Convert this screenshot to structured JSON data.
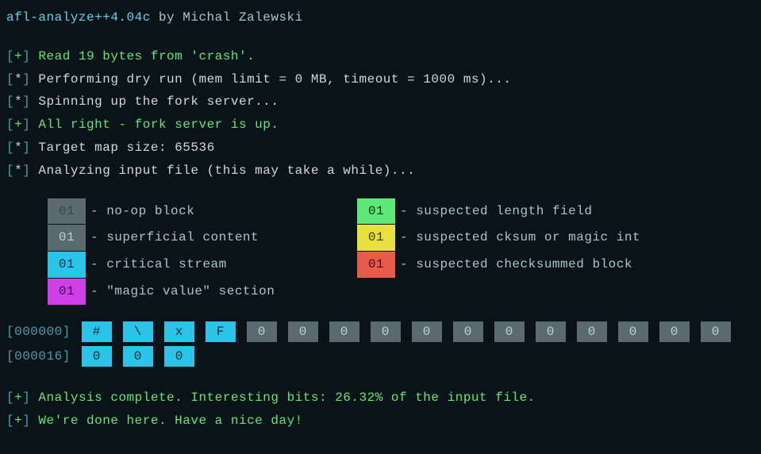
{
  "header": {
    "title": "afl-analyze++4.04c",
    "by": " by Michal Zalewski"
  },
  "logs": [
    {
      "prefix": "[+]",
      "type": "plus",
      "text": " Read 19 bytes from 'crash'."
    },
    {
      "prefix": "[*]",
      "type": "star",
      "text": " Performing dry run (mem limit = 0 MB, timeout = 1000 ms)..."
    },
    {
      "prefix": "[*]",
      "type": "star",
      "text": " Spinning up the fork server..."
    },
    {
      "prefix": "[+]",
      "type": "plus",
      "text": " All right - fork server is up."
    },
    {
      "prefix": "[*]",
      "type": "star",
      "text": " Target map size: 65536"
    },
    {
      "prefix": "[*]",
      "type": "star",
      "text": " Analyzing input file (this may take a while)..."
    }
  ],
  "legend": [
    [
      {
        "swatch": "swatch-gray",
        "code": "01",
        "label": " - no-op block"
      },
      {
        "swatch": "swatch-green",
        "code": "01",
        "label": " - suspected length field"
      }
    ],
    [
      {
        "swatch": "swatch-lightgray",
        "code": "01",
        "label": " - superficial content"
      },
      {
        "swatch": "swatch-yellow",
        "code": "01",
        "label": " - suspected cksum or magic int"
      }
    ],
    [
      {
        "swatch": "swatch-cyan",
        "code": "01",
        "label": " - critical stream"
      },
      {
        "swatch": "swatch-red",
        "code": "01",
        "label": " - suspected checksummed block"
      }
    ],
    [
      {
        "swatch": "swatch-magenta",
        "code": "01",
        "label": " - \"magic value\" section"
      }
    ]
  ],
  "hex": [
    {
      "offset": "[000000]",
      "bytes": [
        {
          "val": "#",
          "cls": "byte-cyan"
        },
        {
          "val": "\\",
          "cls": "byte-cyan"
        },
        {
          "val": "x",
          "cls": "byte-cyan"
        },
        {
          "val": "F",
          "cls": "byte-cyan"
        },
        {
          "val": "0",
          "cls": "byte-gray"
        },
        {
          "val": "0",
          "cls": "byte-gray"
        },
        {
          "val": "0",
          "cls": "byte-gray"
        },
        {
          "val": "0",
          "cls": "byte-gray"
        },
        {
          "val": "0",
          "cls": "byte-gray"
        },
        {
          "val": "0",
          "cls": "byte-gray"
        },
        {
          "val": "0",
          "cls": "byte-gray"
        },
        {
          "val": "0",
          "cls": "byte-gray"
        },
        {
          "val": "0",
          "cls": "byte-gray"
        },
        {
          "val": "0",
          "cls": "byte-gray"
        },
        {
          "val": "0",
          "cls": "byte-gray"
        },
        {
          "val": "0",
          "cls": "byte-gray"
        }
      ]
    },
    {
      "offset": "[000016]",
      "bytes": [
        {
          "val": "0",
          "cls": "byte-cyan"
        },
        {
          "val": "0",
          "cls": "byte-cyan"
        },
        {
          "val": "0",
          "cls": "byte-cyan"
        }
      ]
    }
  ],
  "footer": [
    {
      "prefix": "[+]",
      "type": "plus",
      "text": " Analysis complete. Interesting bits: 26.32% of the input file."
    },
    {
      "prefix": "[+]",
      "type": "plus",
      "text": " We're done here. Have a nice day!"
    }
  ]
}
